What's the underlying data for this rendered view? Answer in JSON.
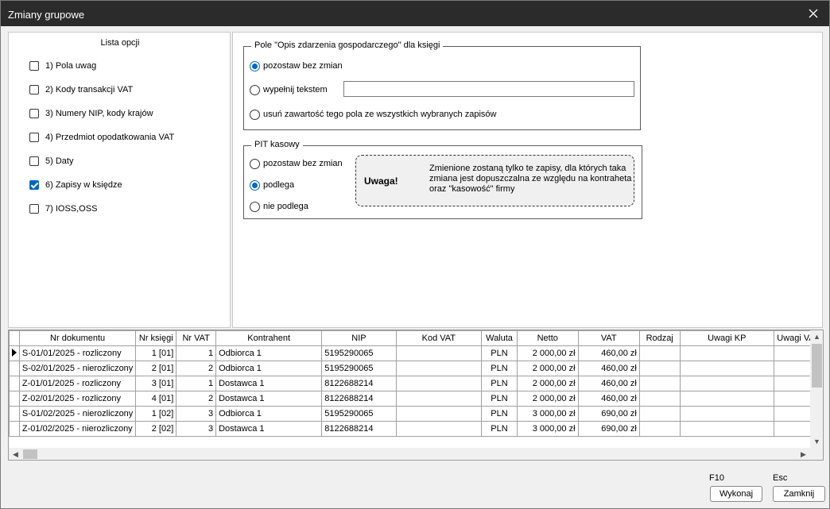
{
  "window": {
    "title": "Zmiany grupowe"
  },
  "options": {
    "header": "Lista opcji",
    "items": [
      {
        "label": "1) Pola uwag",
        "checked": false
      },
      {
        "label": "2) Kody transakcji VAT",
        "checked": false
      },
      {
        "label": "3) Numery NIP, kody krajów",
        "checked": false
      },
      {
        "label": "4) Przedmiot opodatkowania VAT",
        "checked": false
      },
      {
        "label": "5) Daty",
        "checked": false
      },
      {
        "label": "6) Zapisy w księdze",
        "checked": true
      },
      {
        "label": "7) IOSS,OSS",
        "checked": false
      }
    ]
  },
  "opis_group": {
    "legend": "Pole \"Opis zdarzenia gospodarczego\" dla księgi",
    "options": [
      "pozostaw bez zmian",
      "wypełnij tekstem",
      "usuń zawartość tego pola ze wszystkich wybranych zapisów"
    ],
    "selected": "pozostaw bez zmian",
    "text_value": ""
  },
  "pit_group": {
    "legend": "PIT kasowy",
    "options": [
      "pozostaw bez zmian",
      "podlega",
      "nie podlega"
    ],
    "selected": "podlega",
    "note_title": "Uwaga!",
    "note_text": "Zmienione zostaną tylko te zapisy, dla których taka zmiana jest dopuszczalna ze względu na kontraheta oraz \"kasowość\" firmy"
  },
  "grid": {
    "columns": [
      "Nr dokumentu",
      "Nr księgi",
      "Nr VAT",
      "Kontrahent",
      "NIP",
      "Kod VAT",
      "Waluta",
      "Netto",
      "VAT",
      "Rodzaj",
      "Uwagi KP",
      "Uwagi VAT"
    ],
    "rows": [
      [
        "S-01/01/2025 - rozliczony",
        "1 [01]",
        "1",
        "Odbiorca 1",
        "5195290065",
        "",
        "PLN",
        "2 000,00 zł",
        "460,00 zł",
        "",
        "",
        ""
      ],
      [
        "S-02/01/2025 - nierozliczony",
        "2 [01]",
        "2",
        "Odbiorca 1",
        "5195290065",
        "",
        "PLN",
        "2 000,00 zł",
        "460,00 zł",
        "",
        "",
        ""
      ],
      [
        "Z-01/01/2025 - rozliczony",
        "3 [01]",
        "1",
        "Dostawca 1",
        "8122688214",
        "",
        "PLN",
        "2 000,00 zł",
        "460,00 zł",
        "",
        "",
        ""
      ],
      [
        "Z-02/01/2025 - rozliczony",
        "4 [01]",
        "2",
        "Dostawca 1",
        "8122688214",
        "",
        "PLN",
        "2 000,00 zł",
        "460,00 zł",
        "",
        "",
        ""
      ],
      [
        "S-01/02/2025 - nierozliczony",
        "1 [02]",
        "3",
        "Odbiorca 1",
        "5195290065",
        "",
        "PLN",
        "3 000,00 zł",
        "690,00 zł",
        "",
        "",
        ""
      ],
      [
        "Z-01/02/2025 - nierozliczony",
        "2 [02]",
        "3",
        "Dostawca 1",
        "8122688214",
        "",
        "PLN",
        "3 000,00 zł",
        "690,00 zł",
        "",
        "",
        ""
      ]
    ]
  },
  "footer": {
    "execute_key": "F10",
    "execute_label": "Wykonaj",
    "close_key": "Esc",
    "close_label": "Zamknij"
  },
  "colors": {
    "titlebar": "#2b2b2b",
    "accent": "#0067c0"
  }
}
